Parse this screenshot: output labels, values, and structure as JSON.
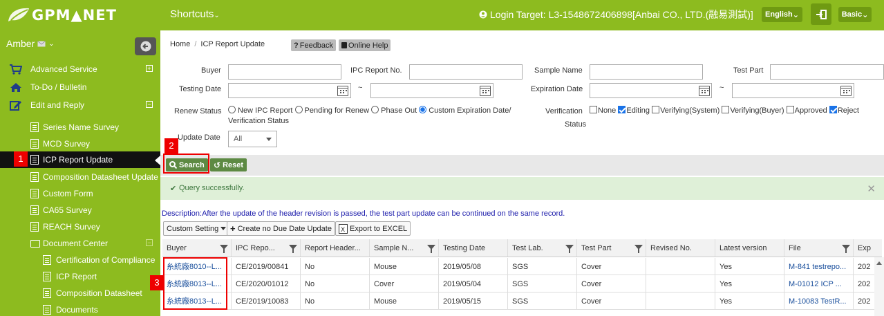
{
  "topbar": {
    "logo_text": "GPM▲NET",
    "shortcuts": "Shortcuts",
    "login_target": "Login Target: L3-1548672406898[Anbai CO., LTD.(融易測試)]",
    "language": "English",
    "basic": "Basic",
    "brand_color": "#8dbb1f"
  },
  "sidebar": {
    "user": "Amber",
    "items": [
      {
        "label": "Advanced Service",
        "icon": "cart-icon"
      },
      {
        "label": "To-Do / Bulletin",
        "icon": "home-icon"
      },
      {
        "label": "Edit and Reply",
        "icon": "edit-icon"
      }
    ],
    "sub_items": [
      "Series Name Survey",
      "MCD Survey",
      "ICP Report Update",
      "Composition Datasheet Update",
      "Custom Form",
      "CA65 Survey",
      "REACH Survey",
      "Document Center"
    ],
    "doc_items": [
      "Certification of Compliance",
      "ICP Report",
      "Composition Datasheet",
      "Documents"
    ]
  },
  "annotations": {
    "n1": "1",
    "n2": "2",
    "n3": "3"
  },
  "breadcrumb": {
    "home": "Home",
    "sep": "/",
    "current": "ICP Report Update"
  },
  "feedback": "Feedback",
  "online_help": "Online Help",
  "form": {
    "buyer": "Buyer",
    "ipc_report_no": "IPC Report No.",
    "sample_name": "Sample Name",
    "test_part": "Test Part",
    "testing_date": "Testing Date",
    "expiration_date": "Expiration Date",
    "tilde": "~",
    "renew_status": "Renew Status",
    "renew_options": [
      "New IPC Report",
      "Pending for Renew",
      "Phase Out",
      "Custom Expiration Date/"
    ],
    "renew_option_cont": "Verification Status",
    "verification": "Verification",
    "verification_status_label": "Status",
    "verification_options": [
      "None",
      "Editing",
      "Verifying(System)",
      "Verifying(Buyer)",
      "Approved",
      "Reject"
    ],
    "update_date": "Update Date",
    "update_date_value": "All"
  },
  "buttons": {
    "search": "Search",
    "reset": "Reset"
  },
  "alert": "Query successfully.",
  "description": "Description:After the update of the header revision is passed, the test part update can be continued on the same record.",
  "toolbar": {
    "custom_setting": "Custom Setting",
    "create_no_due": "Create no Due Date Update",
    "export_excel": "Export to EXCEL"
  },
  "table": {
    "headers": [
      "Buyer",
      "IPC Repo...",
      "Report Header...",
      "Sample N...",
      "Testing Date",
      "Test Lab.",
      "Test Part",
      "Revised No.",
      "Latest version",
      "File",
      "Exp"
    ],
    "rows": [
      [
        "糸統廠8010--L...",
        "CE/2019/00841",
        "No",
        "Mouse",
        "2019/05/08",
        "SGS",
        "Cover",
        "",
        "Yes",
        "M-841 testrepo...",
        "202"
      ],
      [
        "糸統廠8013--L...",
        "CE/2020/01012",
        "No",
        "Cover",
        "2019/05/04",
        "SGS",
        "Cover",
        "",
        "Yes",
        "M-01012 ICP ...",
        "202"
      ],
      [
        "糸統廠8013--L...",
        "CE/2019/10083",
        "No",
        "Mouse",
        "2019/05/15",
        "SGS",
        "Cover",
        "",
        "Yes",
        "M-10083 TestR...",
        "202"
      ]
    ]
  }
}
